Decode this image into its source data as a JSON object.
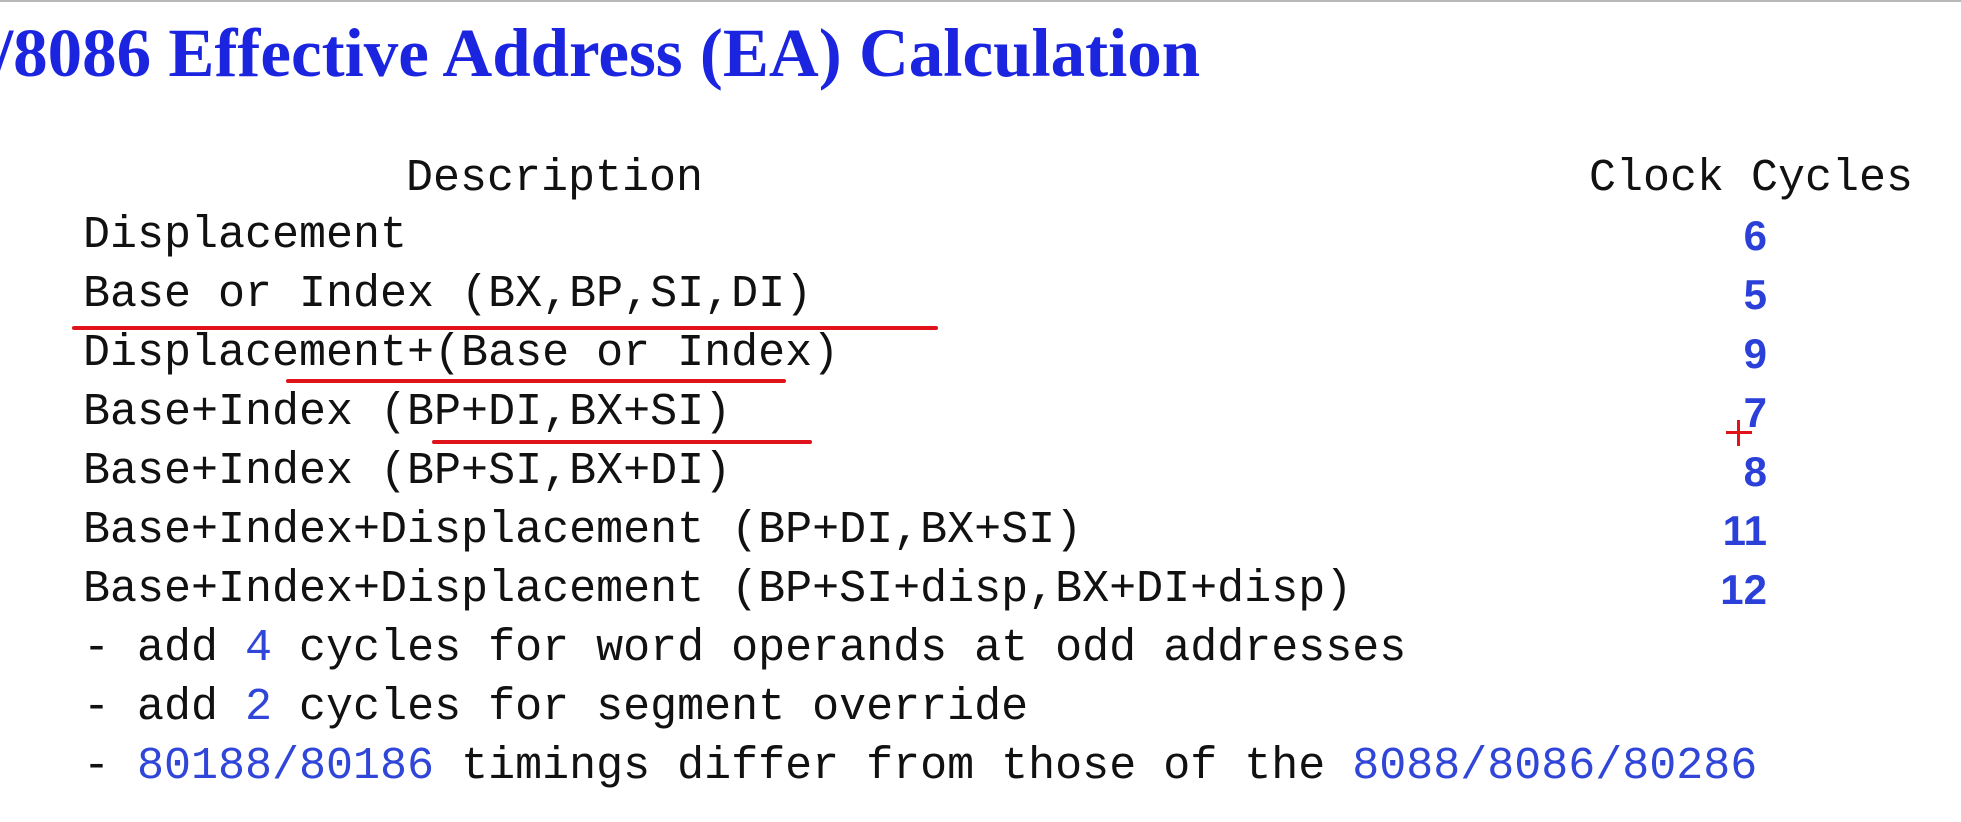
{
  "title": "/8086 Effective Address (EA) Calculation",
  "headers": {
    "description": "Description",
    "cycles": "Clock Cycles"
  },
  "rows": [
    {
      "description": "Displacement",
      "cycles": "6"
    },
    {
      "description": "Base or Index (BX,BP,SI,DI)",
      "cycles": "5"
    },
    {
      "description": "Displacement+(Base or Index)",
      "cycles": "9"
    },
    {
      "description": "Base+Index (BP+DI,BX+SI)",
      "cycles": "7"
    },
    {
      "description": "Base+Index (BP+SI,BX+DI)",
      "cycles": "8"
    },
    {
      "description": "Base+Index+Displacement (BP+DI,BX+SI)",
      "cycles": "11"
    },
    {
      "description": "Base+Index+Displacement (BP+SI+disp,BX+DI+disp)",
      "cycles": "12"
    }
  ],
  "notes": {
    "word_operands": {
      "prefix": "- add ",
      "value": "4",
      "suffix": " cycles for word operands at odd addresses"
    },
    "segment_override": {
      "prefix": "- add ",
      "value": "2",
      "suffix": " cycles for segment override"
    },
    "timings": {
      "prefix": "- ",
      "cpus_a": "80188/80186",
      "middle": " timings differ from those of the ",
      "cpus_b": "8088/8086/80286"
    }
  },
  "colors": {
    "title": "#1b25e0",
    "highlight": "#2b40d8",
    "annotation": "#e0121a"
  }
}
